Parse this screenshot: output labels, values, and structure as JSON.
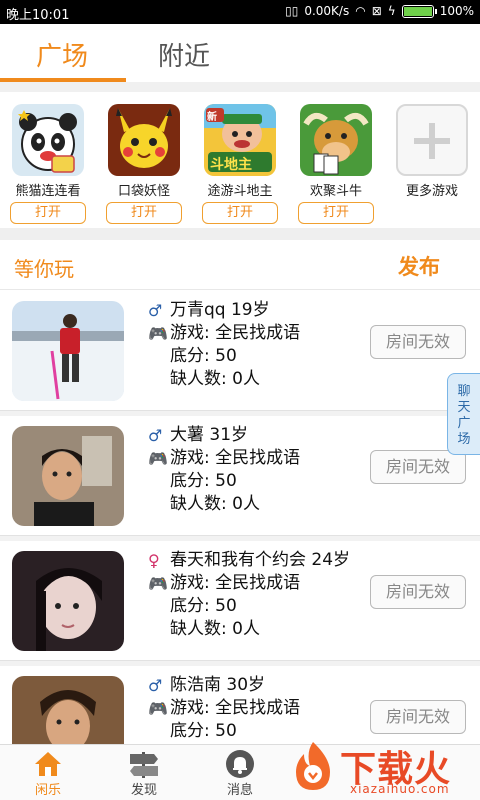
{
  "status_bar": {
    "time": "晚上10:01",
    "net_speed": "0.00K/s",
    "battery": "100%",
    "battery_level": 1.0
  },
  "tabs": [
    {
      "label": "广场",
      "active": true
    },
    {
      "label": "附近",
      "active": false
    }
  ],
  "games": [
    {
      "name": "熊猫连连看",
      "button": "打开",
      "icon": "panda-game-icon"
    },
    {
      "name": "口袋妖怪",
      "button": "打开",
      "icon": "pikachu-game-icon"
    },
    {
      "name": "途游斗地主",
      "button": "打开",
      "icon": "doudizhu-game-icon"
    },
    {
      "name": "欢聚斗牛",
      "button": "打开",
      "icon": "bull-game-icon"
    }
  ],
  "more_games_label": "更多游戏",
  "section": {
    "title": "等你玩",
    "publish": "发布"
  },
  "rooms": [
    {
      "gender": "male",
      "name_age": "万青qq 19岁",
      "game": "游戏: 全民找成语",
      "score": "底分: 50",
      "missing": "缺人数: 0人",
      "button": "房间无效"
    },
    {
      "gender": "male",
      "name_age": "大薯 31岁",
      "game": "游戏: 全民找成语",
      "score": "底分: 50",
      "missing": "缺人数: 0人",
      "button": "房间无效"
    },
    {
      "gender": "female",
      "name_age": "春天和我有个约会 24岁",
      "game": "游戏: 全民找成语",
      "score": "底分: 50",
      "missing": "缺人数: 0人",
      "button": "房间无效"
    },
    {
      "gender": "male",
      "name_age": "陈浩南 30岁",
      "game": "游戏: 全民找成语",
      "score": "底分: 50",
      "missing": "",
      "button": "房间无效"
    }
  ],
  "chat_tab": [
    "聊",
    "天",
    "广",
    "场"
  ],
  "bottom_nav": [
    {
      "label": "闲乐",
      "icon": "home-icon",
      "active": true
    },
    {
      "label": "发现",
      "icon": "signpost-icon",
      "active": false
    },
    {
      "label": "消息",
      "icon": "bell-icon",
      "active": false
    }
  ],
  "watermark": {
    "text": "下载火",
    "sub": "xiazaihuo.com"
  },
  "colors": {
    "accent": "#f08a1c",
    "male": "#2a5fa8",
    "female": "#d2336a"
  }
}
